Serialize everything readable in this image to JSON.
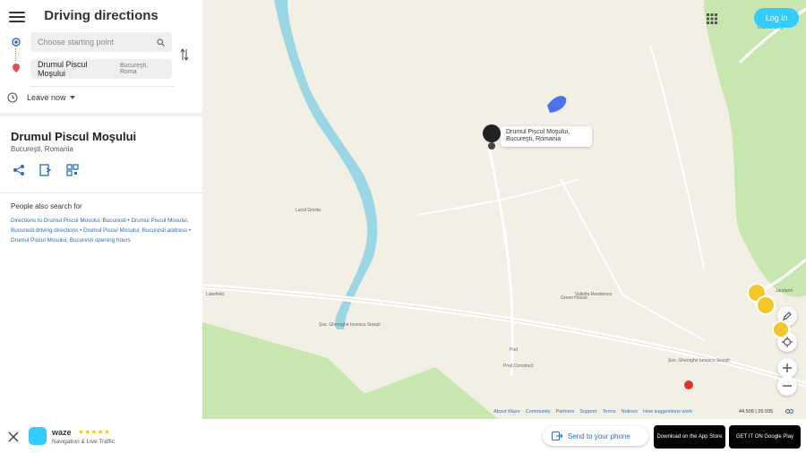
{
  "header": {
    "title": "Driving directions",
    "login_label": "Log in"
  },
  "search": {
    "start_placeholder": "Choose starting point",
    "destination_name": "Drumul Piscul Moşului",
    "destination_city": "Bucureşti, Roma"
  },
  "leave": {
    "label": "Leave now"
  },
  "place": {
    "title": "Drumul Piscul Moşului",
    "subtitle": "Bucureşti, Romania"
  },
  "also_search": {
    "heading": "People also search for",
    "links": [
      "Directions to Drumul Piscul Mosului, Bucuresti",
      "Drumul Piscul Mosului, Bucuresti driving directions",
      "Drumul Piscul Mosului, Bucuresti address",
      "Drumul Piscul Mosului, Bucuresti opening hours"
    ]
  },
  "map": {
    "popup_line1": "Drumul Piscul Moşului,",
    "popup_line2": "Bucureşti, Romania",
    "labels": {
      "lake": "Lacul Grivita",
      "residence": "Valletta Residence",
      "green_house": "Green House",
      "lakefield": "Lakefield",
      "road1": "Şos. Gheorghe Ionescu Sisești",
      "road2": "Şos. Gheorghe Ionescu Sisești",
      "pod": "Pod",
      "prod": "Prod Construct",
      "drumul_steg": "Drumul Steg",
      "jandarm": "Jandarm"
    },
    "colors": {
      "land": "#f2efe4",
      "water": "#9ad6e3",
      "park": "#c8e6b0",
      "road": "#ffffff"
    }
  },
  "footer": {
    "links": [
      "About Waze",
      "Community",
      "Partners",
      "Support",
      "Terms",
      "Notices",
      "How suggestions work"
    ],
    "coords": "44.509 | 26.035"
  },
  "bottom": {
    "brand": "waze",
    "stars": "★★★★★",
    "tagline": "Navigation & Live Traffic",
    "send_label": "Send to your phone",
    "app_store": "Download on the App Store",
    "google_play": "GET IT ON Google Play"
  }
}
